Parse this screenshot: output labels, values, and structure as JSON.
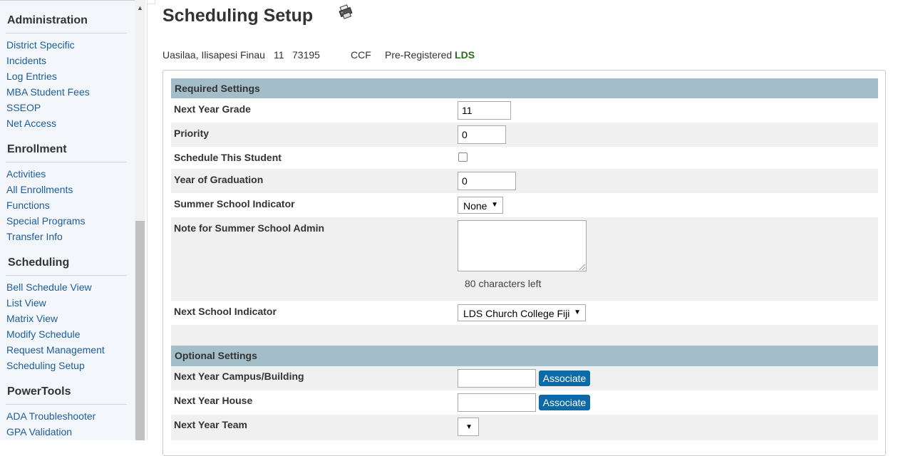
{
  "sidebar": {
    "sections": [
      {
        "title": "Administration",
        "items": [
          "District Specific",
          "Incidents",
          "Log Entries",
          "MBA Student Fees",
          "SSEOP",
          "Net Access"
        ]
      },
      {
        "title": "Enrollment",
        "items": [
          "Activities",
          "All Enrollments",
          "Functions",
          "Special Programs",
          "Transfer Info"
        ]
      },
      {
        "title": "Scheduling",
        "items": [
          "Bell Schedule View",
          "List View",
          "Matrix View",
          "Modify Schedule",
          "Request Management",
          "Scheduling Setup"
        ]
      },
      {
        "title": "PowerTools",
        "items": [
          "ADA Troubleshooter",
          "GPA Validation"
        ]
      }
    ]
  },
  "page": {
    "title": "Scheduling Setup",
    "title_icon": "printer-icon"
  },
  "student": {
    "name": "Uasilaa, Ilisapesi Finau",
    "grade": "11",
    "id": "73195",
    "school": "CCF",
    "status": "Pre-Registered",
    "status_code": "LDS"
  },
  "required_settings": {
    "header": "Required Settings",
    "next_year_grade": {
      "label": "Next Year Grade",
      "value": "11"
    },
    "priority": {
      "label": "Priority",
      "value": "0"
    },
    "schedule_this_student": {
      "label": "Schedule This Student",
      "checked": false
    },
    "year_of_graduation": {
      "label": "Year of Graduation",
      "value": "0"
    },
    "summer_school_indicator": {
      "label": "Summer School Indicator",
      "selected": "None"
    },
    "note_for_summer_school_admin": {
      "label": "Note for Summer School Admin",
      "value": "",
      "chars_left": "80 characters left"
    },
    "next_school_indicator": {
      "label": "Next School Indicator",
      "selected": "LDS Church College Fiji"
    }
  },
  "optional_settings": {
    "header": "Optional Settings",
    "next_year_campus_building": {
      "label": "Next Year Campus/Building",
      "value": "",
      "button": "Associate"
    },
    "next_year_house": {
      "label": "Next Year House",
      "value": "",
      "button": "Associate"
    },
    "next_year_team": {
      "label": "Next Year Team",
      "selected": ""
    }
  },
  "colors": {
    "link": "#1d5d9b",
    "header_bar": "#a3bdc9",
    "button": "#0c6aa6",
    "status_code": "#2c6e1f"
  }
}
